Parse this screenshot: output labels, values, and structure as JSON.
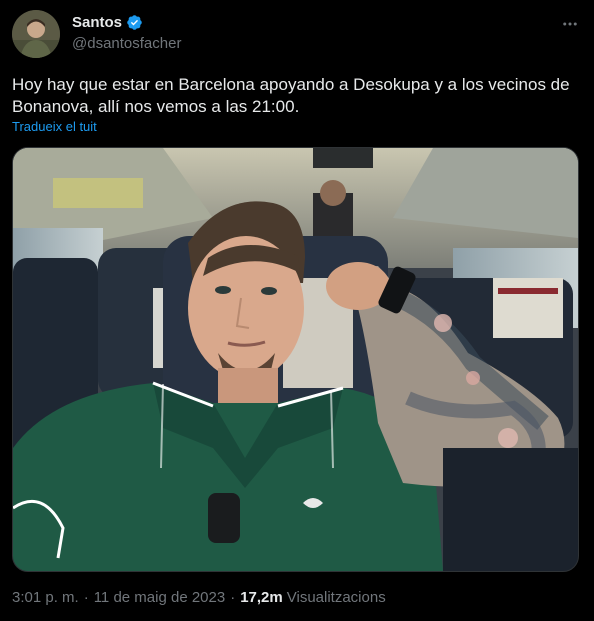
{
  "author": {
    "display_name": "Santos",
    "handle": "@dsantosfacher",
    "verified_color": "#1d9bf0",
    "avatar_icon": "user-avatar"
  },
  "tweet": {
    "text": "Hoy hay que estar en Barcelona apoyando a Desokupa y a los vecinos de\nBonanova, allí nos vemos a las 21:00.",
    "translate_label": "Tradueix el tuit"
  },
  "meta": {
    "time": "3:01 p. m.",
    "separator": "·",
    "date": "11 de maig de 2023",
    "views_count": "17,2m",
    "views_label": "Visualitzacions"
  },
  "colors": {
    "background": "#000000",
    "text": "#e7e9ea",
    "secondary": "#71767b",
    "link": "#1d9bf0"
  }
}
